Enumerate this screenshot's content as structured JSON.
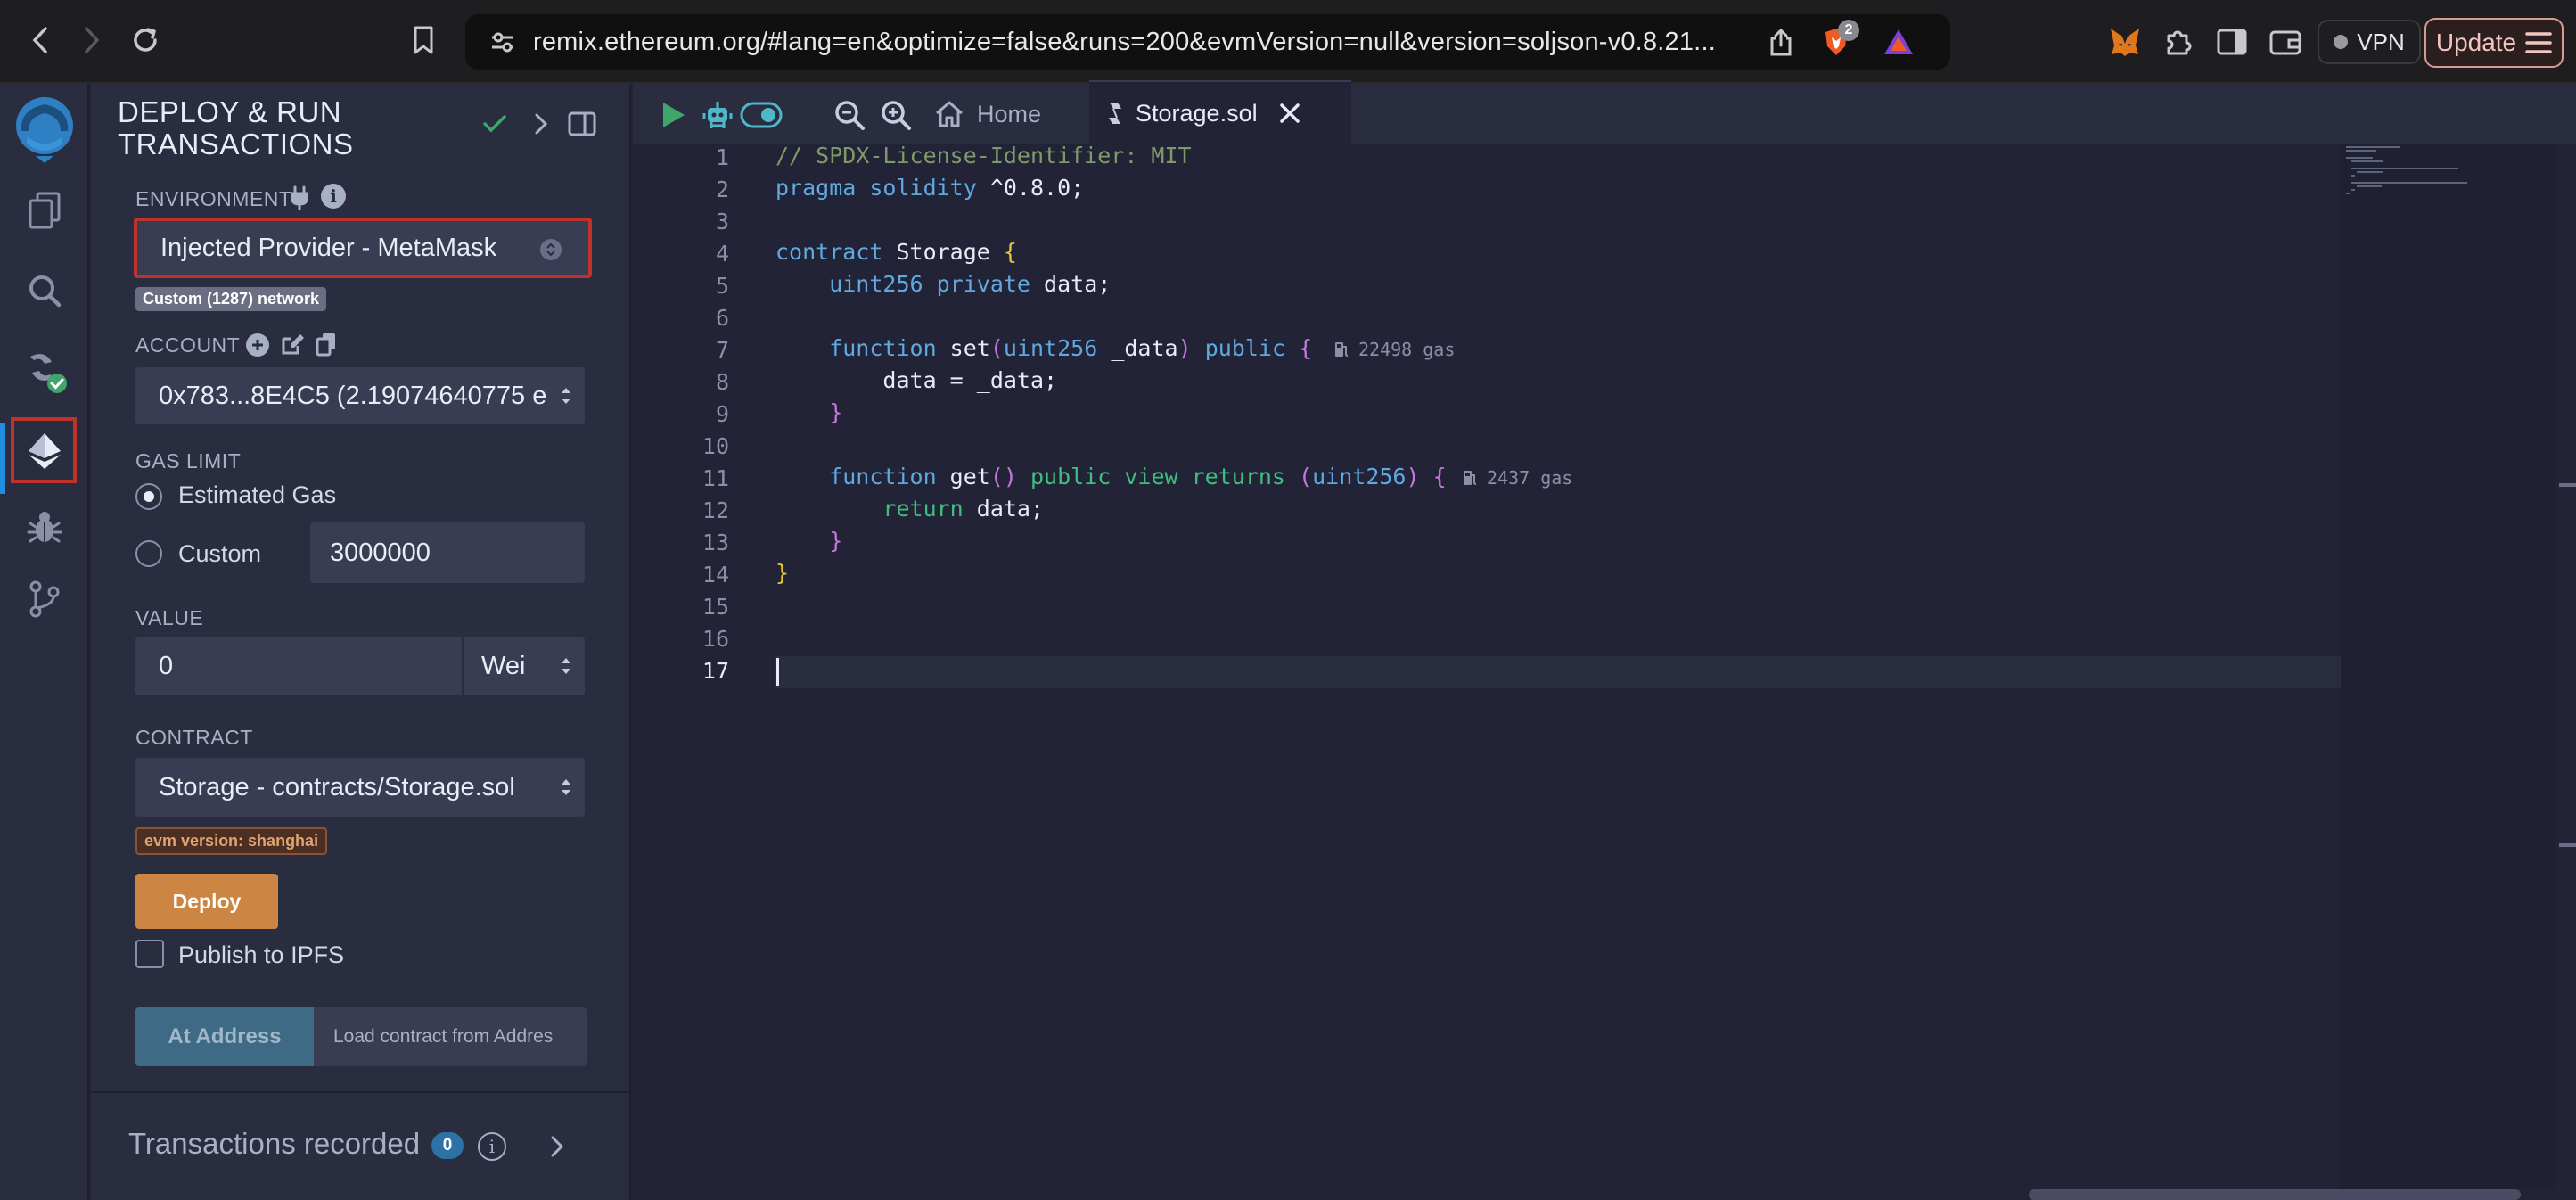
{
  "browser": {
    "url": "remix.ethereum.org/#lang=en&optimize=false&runs=200&evmVersion=null&version=soljson-v0.8.21...",
    "brave_badge_count": "2",
    "vpn_label": "VPN",
    "update_label": "Update"
  },
  "sidepanel": {
    "title_line1": "DEPLOY & RUN",
    "title_line2": "TRANSACTIONS",
    "environment_label": "ENVIRONMENT",
    "environment_value": "Injected Provider - MetaMask",
    "network_badge": "Custom (1287) network",
    "account_label": "ACCOUNT",
    "account_value": "0x783...8E4C5 (2.19074640775 e",
    "gas_limit_label": "GAS LIMIT",
    "gas_estimated_label": "Estimated Gas",
    "gas_custom_label": "Custom",
    "gas_custom_value": "3000000",
    "value_label": "VALUE",
    "value_amount": "0",
    "value_unit": "Wei",
    "contract_label": "CONTRACT",
    "contract_value": "Storage - contracts/Storage.sol",
    "evm_badge": "evm version: shanghai",
    "deploy_label": "Deploy",
    "publish_ipfs_label": "Publish to IPFS",
    "at_address_label": "At Address",
    "load_contract_placeholder": "Load contract from Addres",
    "transactions_recorded_label": "Transactions recorded",
    "transactions_count": "0"
  },
  "editor": {
    "tab_home": "Home",
    "tab_file": "Storage.sol",
    "line_numbers": [
      "1",
      "2",
      "3",
      "4",
      "5",
      "6",
      "7",
      "8",
      "9",
      "10",
      "11",
      "12",
      "13",
      "14",
      "15",
      "16",
      "17"
    ],
    "current_line": "17",
    "code": {
      "l1": "// SPDX-License-Identifier: MIT",
      "l2_kw": "pragma solidity",
      "l2_rest": " ^0.8.0;",
      "l4_kw": "contract",
      "l4_name": " Storage ",
      "l4_brace": "{",
      "l5_type": "    uint256 private",
      "l5_rest": " data;",
      "l7_kw": "    function",
      "l7_name": " set",
      "l7_paren_open": "(",
      "l7_type": "uint256",
      "l7_arg": " _data",
      "l7_paren_close": ")",
      "l7_mod": " public ",
      "l7_brace": "{",
      "l8": "        data = _data;",
      "l9": "    }",
      "l11_kw": "    function",
      "l11_name": " get",
      "l11_parens": "()",
      "l11_mod": " public view",
      "l11_returns": " returns",
      "l11_paren_open": " (",
      "l11_type": "uint256",
      "l11_paren_close": ")",
      "l11_brace": " {",
      "l12_kw": "        return",
      "l12_rest": " data;",
      "l13": "    }",
      "l14": "}"
    },
    "gas_set": "22498 gas",
    "gas_get": "2437 gas"
  }
}
